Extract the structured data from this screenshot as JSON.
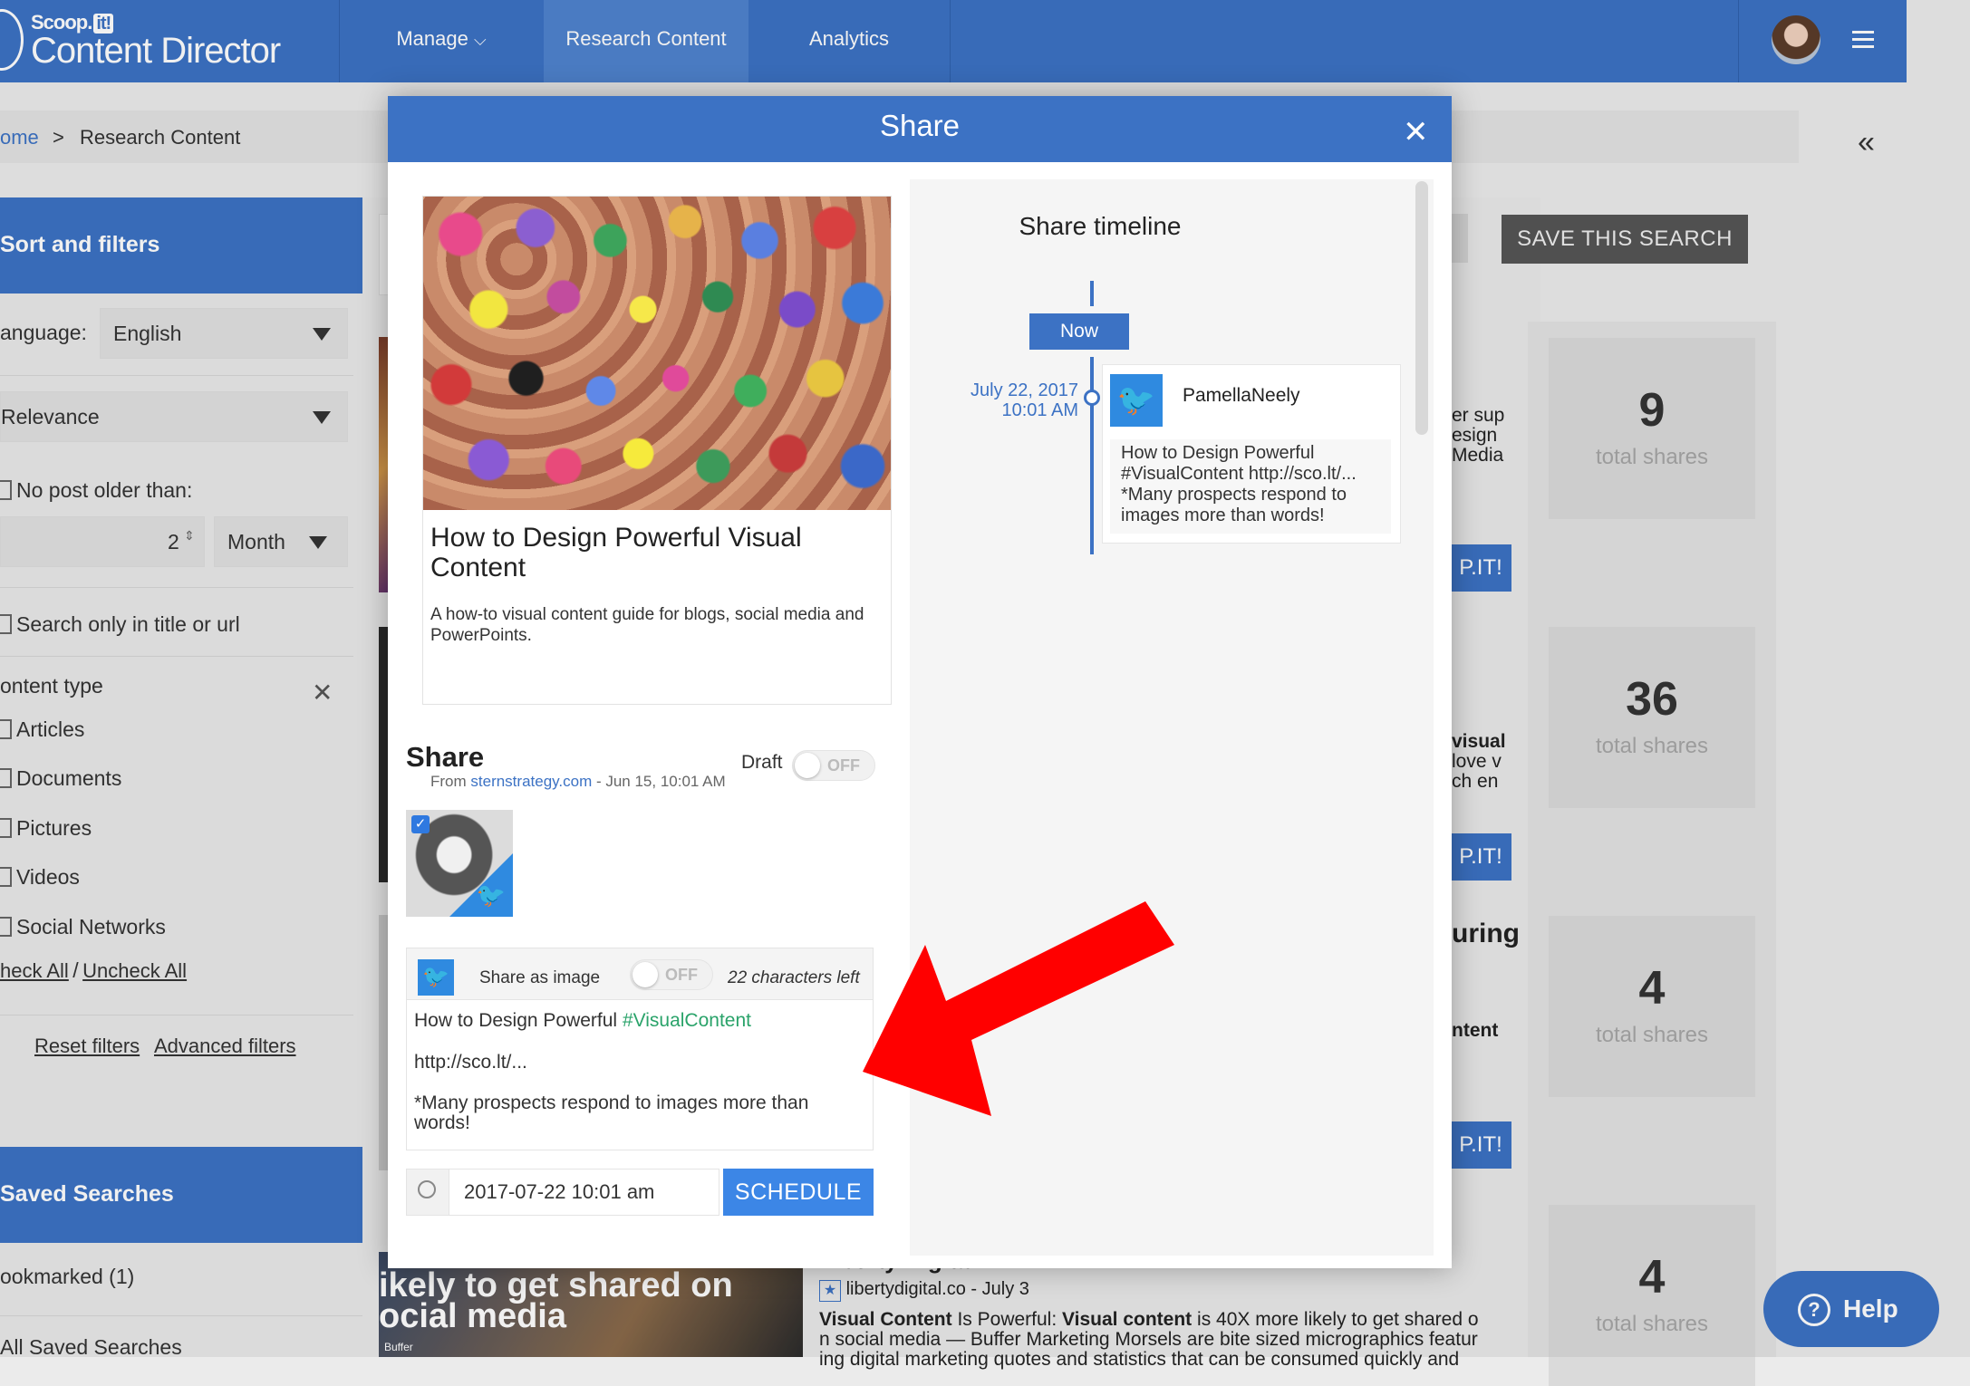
{
  "app": {
    "logo_small": "Scoop.",
    "logo_badge": "it!",
    "logo_main": "Content Director"
  },
  "nav": {
    "manage": "Manage",
    "research": "Research Content",
    "analytics": "Analytics"
  },
  "breadcrumb": {
    "home": "ome",
    "sep": ">",
    "current": "Research Content"
  },
  "sidebar": {
    "sort_title": "Sort and filters",
    "language_label": "anguage:",
    "language_value": "English",
    "sort_value": "Relevance",
    "older_label": "No post older than:",
    "older_number": "2",
    "older_unit": "Month",
    "title_only": "Search only in title or url",
    "content_type": "ontent type",
    "types": [
      "Articles",
      "Documents",
      "Pictures",
      "Videos",
      "Social Networks"
    ],
    "check_all": "heck All",
    "slash": "/",
    "uncheck_all": "Uncheck All",
    "reset": "Reset filters",
    "advanced": "Advanced filters",
    "saved_title": "Saved Searches",
    "bookmarked": "ookmarked (1)",
    "all_saved": "All Saved Searches"
  },
  "results": {
    "save_search": "SAVE THIS SEARCH",
    "scoopit": "P.IT!",
    "shares": [
      {
        "num": "9",
        "label": "total shares"
      },
      {
        "num": "36",
        "label": "total shares"
      },
      {
        "num": "4",
        "label": "total shares"
      },
      {
        "num": "4",
        "label": "total shares"
      }
    ],
    "clip1": [
      "er sup",
      "esign",
      "Media"
    ],
    "clip2": [
      "visual",
      "love v",
      "ch en"
    ],
    "clip3": [
      "uring",
      "ntent"
    ],
    "bottom_img_line1": "ikely to get shared on",
    "bottom_img_line2": "ocial media",
    "bottom_img_tag": "Buffer",
    "bottom_title": "Liberty Digital",
    "bottom_source": "libertydigital.co - July 3",
    "bottom_snip1_b1": "Visual Content",
    "bottom_snip1_t1": " Is Powerful: ",
    "bottom_snip1_b2": "Visual content",
    "bottom_snip1_t2": " is 40X more likely to get shared o",
    "bottom_snip2": "n social media — Buffer Marketing Morsels are bite sized micrographics featur",
    "bottom_snip3": "ing digital marketing quotes and statistics that can be consumed quickly and"
  },
  "help": {
    "label": "Help",
    "q": "?"
  },
  "modal": {
    "title": "Share",
    "close": "✕",
    "card_title": "How to Design Powerful Visual Content",
    "card_desc": "A how-to visual content guide for blogs, social media and PowerPoints.",
    "card_from_label": "From ",
    "card_from_link": "sternstrategy.com",
    "card_from_date": " - Jun 15, 10:01 AM",
    "share_heading": "Share",
    "draft_label": "Draft",
    "draft_state": "OFF",
    "share_as_image": "Share as image",
    "share_as_image_state": "OFF",
    "chars_left": "22 characters left",
    "msg_prefix": "How to Design Powerful ",
    "msg_hashtag": "#VisualContent",
    "msg_link": "http://sco.lt/...",
    "msg_body": "*Many prospects respond to images more than words!",
    "schedule_date": "2017-07-22 10:01 am",
    "schedule_button": "SCHEDULE",
    "timeline_title": "Share timeline",
    "now_label": "Now",
    "tl_date_line1": "July 22, 2017",
    "tl_date_line2": "10:01 AM",
    "tl_user": "PamellaNeely",
    "tl_body": "How to Design Powerful #VisualContent http://sco.lt/... *Many prospects respond to images more than words!"
  },
  "colors": {
    "brand_blue": "#3c72c4",
    "twitter_blue": "#2f8ae0",
    "hashtag_green": "#2aa36a",
    "annotation_red": "#ff0000"
  }
}
